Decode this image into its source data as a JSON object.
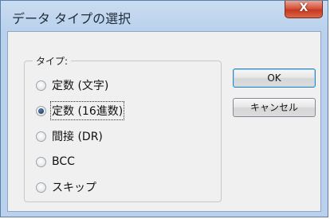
{
  "window": {
    "title": "データ タイプの選択",
    "close_glyph": "X"
  },
  "group": {
    "label": "タイプ:",
    "options": [
      {
        "label": "定数 (文字)",
        "checked": false
      },
      {
        "label": "定数 (16進数)",
        "checked": true
      },
      {
        "label": "間接 (DR)",
        "checked": false
      },
      {
        "label": "BCC",
        "checked": false
      },
      {
        "label": "スキップ",
        "checked": false
      }
    ]
  },
  "buttons": {
    "ok_label": "OK",
    "cancel_label": "キャンセル"
  },
  "colors": {
    "titlebar": "#b9d1ec",
    "client": "#f0f0f0",
    "close": "#c5391f"
  }
}
